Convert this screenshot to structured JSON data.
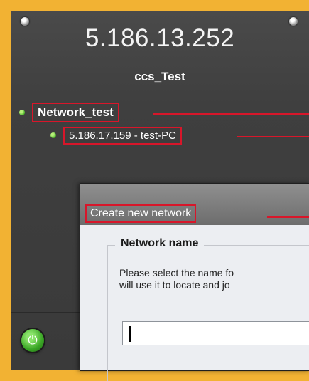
{
  "header": {
    "ip_address": "5.186.13.252",
    "host_name": "ccs_Test"
  },
  "tree": {
    "network": {
      "label": "Network_test",
      "status": "online"
    },
    "client": {
      "label": "5.186.17.159 - test-PC",
      "status": "online"
    }
  },
  "power_button": {
    "icon": "power-icon",
    "glyph": "⏻"
  },
  "dialog": {
    "title": "Create new network",
    "section_title": "Network name",
    "description_line1": "Please select the name fo",
    "description_line2": "will use it to locate and jo",
    "input_value": ""
  },
  "colors": {
    "frame": "#f2b233",
    "callout": "#d8162a",
    "status_online": "#4bb22a"
  }
}
